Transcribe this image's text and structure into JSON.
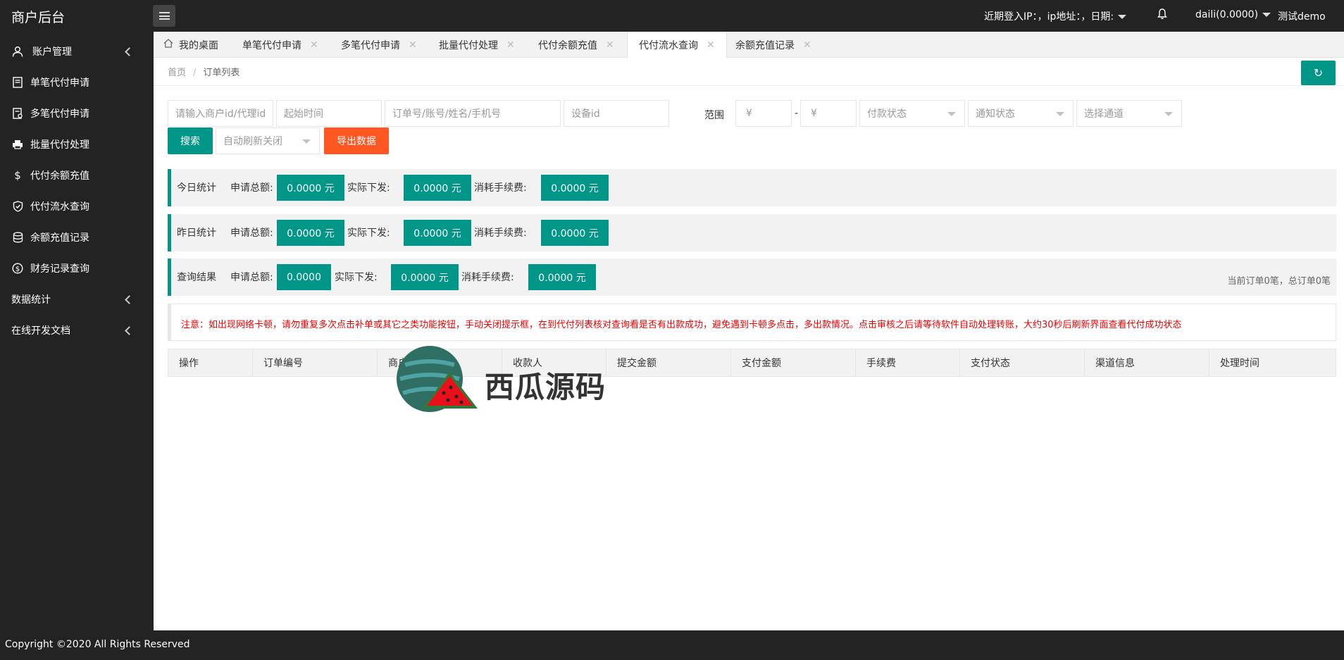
{
  "app": {
    "title": "商户后台"
  },
  "header": {
    "login_info": "近期登入IP：，ip地址：，日期:",
    "user_balance": "daili(0.0000)",
    "user_name": "测试demo"
  },
  "sidebar": {
    "items": [
      {
        "label": "账户管理",
        "icon": "user-icon"
      },
      {
        "label": "单笔代付申请",
        "icon": "document-icon"
      },
      {
        "label": "多笔代付申请",
        "icon": "documents-icon"
      },
      {
        "label": "批量代付处理",
        "icon": "printer-icon"
      },
      {
        "label": "代付余额充值",
        "icon": "dollar-icon"
      },
      {
        "label": "代付流水查询",
        "icon": "shield-check-icon"
      },
      {
        "label": "余额充值记录",
        "icon": "database-icon"
      },
      {
        "label": "财务记录查询",
        "icon": "coin-icon"
      },
      {
        "label": "数据统计"
      },
      {
        "label": "在线开发文档"
      }
    ]
  },
  "tabs": [
    {
      "label": "我的桌面"
    },
    {
      "label": "单笔代付申请"
    },
    {
      "label": "多笔代付申请"
    },
    {
      "label": "批量代付处理"
    },
    {
      "label": "代付余额充值"
    },
    {
      "label": "代付流水查询",
      "active": true
    },
    {
      "label": "余额充值记录"
    }
  ],
  "breadcrumb": {
    "home": "首页",
    "sep": "/",
    "current": "订单列表"
  },
  "refresh_icon": "↻",
  "filters": {
    "merchant_placeholder": "请输入商户id/代理id",
    "start_time_placeholder": "起始时间",
    "order_placeholder": "订单号/账号/姓名/手机号",
    "device_placeholder": "设备id",
    "range_label": "范围",
    "min_placeholder": "¥",
    "range_dash": "-",
    "max_placeholder": "¥",
    "pay_status": "付款状态",
    "notify_status": "通知状态",
    "channel": "选择通道",
    "search_button": "搜索",
    "auto_refresh": "自动刷新关闭",
    "export_button": "导出数据"
  },
  "stats": [
    {
      "title": "今日统计",
      "apply_label": "申请总额:",
      "apply_value": "0.0000 元",
      "actual_label": "实际下发:",
      "actual_value": "0.0000 元",
      "fee_label": "消耗手续费:",
      "fee_value": "0.0000 元"
    },
    {
      "title": "昨日统计",
      "apply_label": "申请总额:",
      "apply_value": "0.0000 元",
      "actual_label": "实际下发:",
      "actual_value": "0.0000 元",
      "fee_label": "消耗手续费:",
      "fee_value": "0.0000 元"
    },
    {
      "title": "查询结果",
      "apply_label": "申请总额:",
      "apply_value": "0.0000",
      "actual_label": "实际下发:",
      "actual_value": "0.0000 元",
      "fee_label": "消耗手续费:",
      "fee_value": "0.0000 元"
    }
  ],
  "order_count": "当前订单0笔，总订单0笔",
  "notice": "注意：如出现网络卡顿，请勿重复多次点击补单或其它之类功能按钮，手动关闭提示框，在到代付列表核对查询看是否有出款成功，避免遇到卡顿多点击，多出款情况。点击审核之后请等待软件自动处理转账，大约30秒后刷新界面查看代付成功状态",
  "table": {
    "columns": [
      "操作",
      "订单编号",
      "商户",
      "收款人",
      "提交金额",
      "支付金额",
      "手续费",
      "支付状态",
      "渠道信息",
      "处理时间"
    ]
  },
  "watermark": {
    "text": "西瓜源码"
  },
  "footer": {
    "copyright": "Copyright ©2020 All Rights Reserved"
  },
  "colors": {
    "accent": "#009688",
    "export": "#FF5722",
    "dark": "#232323",
    "notice": "#EE0000"
  }
}
